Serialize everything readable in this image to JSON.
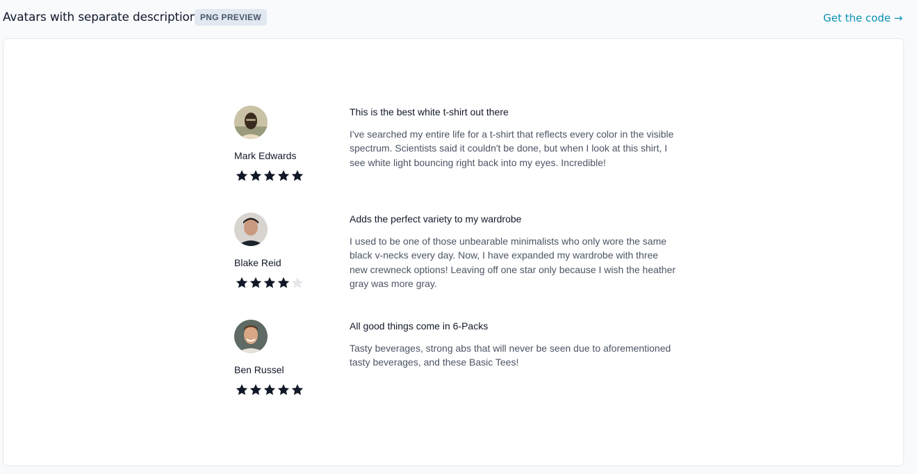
{
  "header": {
    "title": "Avatars with separate description",
    "badge": "PNG PREVIEW",
    "link": "Get the code →"
  },
  "colors": {
    "star_filled": "#111827",
    "star_empty": "#e5e7eb",
    "link": "#0891b2"
  },
  "reviews": [
    {
      "author": "Mark Edwards",
      "rating": 5,
      "headline": "This is the best white t-shirt out there",
      "body": "I've searched my entire life for a t-shirt that reflects every color in the visible spectrum. Scientists said it couldn't be done, but when I look at this shirt, I see white light bouncing right back into my eyes. Incredible!"
    },
    {
      "author": "Blake Reid",
      "rating": 4,
      "headline": "Adds the perfect variety to my wardrobe",
      "body": "I used to be one of those unbearable minimalists who only wore the same black v-necks every day. Now, I have expanded my wardrobe with three new crewneck options! Leaving off one star only because I wish the heather gray was more gray."
    },
    {
      "author": "Ben Russel",
      "rating": 5,
      "headline": "All good things come in 6-Packs",
      "body": "Tasty beverages, strong abs that will never be seen due to aforementioned tasty beverages, and these Basic Tees!"
    }
  ]
}
